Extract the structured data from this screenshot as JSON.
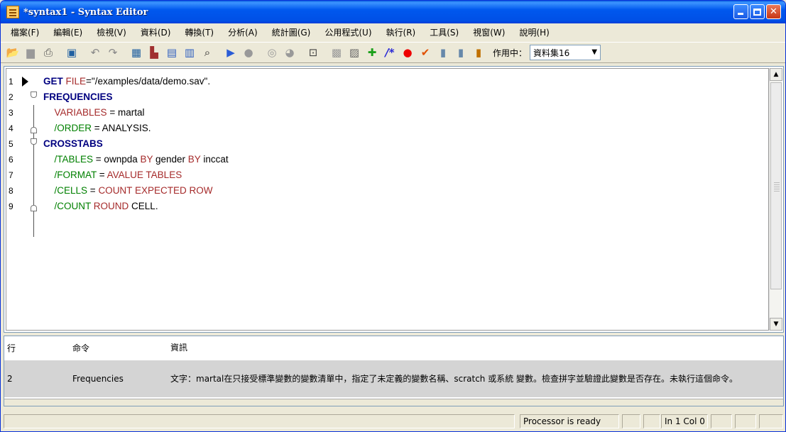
{
  "window": {
    "title": "*syntax1 - Syntax Editor"
  },
  "menu": [
    {
      "label": "檔案(F)"
    },
    {
      "label": "編輯(E)"
    },
    {
      "label": "檢視(V)"
    },
    {
      "label": "資料(D)"
    },
    {
      "label": "轉換(T)"
    },
    {
      "label": "分析(A)"
    },
    {
      "label": "統計圖(G)"
    },
    {
      "label": "公用程式(U)"
    },
    {
      "label": "執行(R)"
    },
    {
      "label": "工具(S)"
    },
    {
      "label": "視窗(W)"
    },
    {
      "label": "說明(H)"
    }
  ],
  "toolbar": {
    "active_label": "作用中：",
    "dataset_value": "資料集16"
  },
  "editor": {
    "lines": [
      {
        "num": "1",
        "parts": [
          [
            "kw",
            "GET"
          ],
          [
            "txt",
            " "
          ],
          [
            "kw2",
            "FILE"
          ],
          [
            "txt",
            "=\"/examples/data/demo.sav\"."
          ]
        ]
      },
      {
        "num": "2",
        "parts": [
          [
            "kw",
            "FREQUENCIES"
          ]
        ]
      },
      {
        "num": "3",
        "parts": [
          [
            "txt",
            "  "
          ],
          [
            "kw2",
            "VARIABLES"
          ],
          [
            "txt",
            " = martal"
          ]
        ]
      },
      {
        "num": "4",
        "parts": [
          [
            "txt",
            "  "
          ],
          [
            "sub",
            "/ORDER"
          ],
          [
            "txt",
            " = ANALYSIS."
          ]
        ]
      },
      {
        "num": "5",
        "parts": [
          [
            "kw",
            "CROSSTABS"
          ]
        ]
      },
      {
        "num": "6",
        "parts": [
          [
            "txt",
            "  "
          ],
          [
            "sub",
            "/TABLES"
          ],
          [
            "txt",
            " = ownpda "
          ],
          [
            "kw2",
            "BY"
          ],
          [
            "txt",
            " gender "
          ],
          [
            "kw2",
            "BY"
          ],
          [
            "txt",
            " inccat"
          ]
        ]
      },
      {
        "num": "7",
        "parts": [
          [
            "txt",
            "  "
          ],
          [
            "sub",
            "/FORMAT"
          ],
          [
            "txt",
            " = "
          ],
          [
            "kw2",
            "AVALUE TABLES"
          ]
        ]
      },
      {
        "num": "8",
        "parts": [
          [
            "txt",
            "  "
          ],
          [
            "sub",
            "/CELLS"
          ],
          [
            "txt",
            " = "
          ],
          [
            "kw2",
            "COUNT EXPECTED ROW"
          ]
        ]
      },
      {
        "num": "9",
        "parts": [
          [
            "txt",
            "  "
          ],
          [
            "sub",
            "/COUNT"
          ],
          [
            "txt",
            " "
          ],
          [
            "kw2",
            "ROUND"
          ],
          [
            "txt",
            " CELL."
          ]
        ]
      }
    ]
  },
  "errors": {
    "headers": {
      "line": "行",
      "command": "命令",
      "info": "資訊"
    },
    "rows": [
      {
        "line": "2",
        "command": "Frequencies",
        "info": "文字：martal在只接受標準變數的變數清單中，指定了未定義的變數名稱、scratch 或系統 變數。檢查拼字並驗證此變數是否存在。未執行這個命令。"
      }
    ]
  },
  "status": {
    "processor": "Processor is ready",
    "position": "In 1 Col 0"
  }
}
